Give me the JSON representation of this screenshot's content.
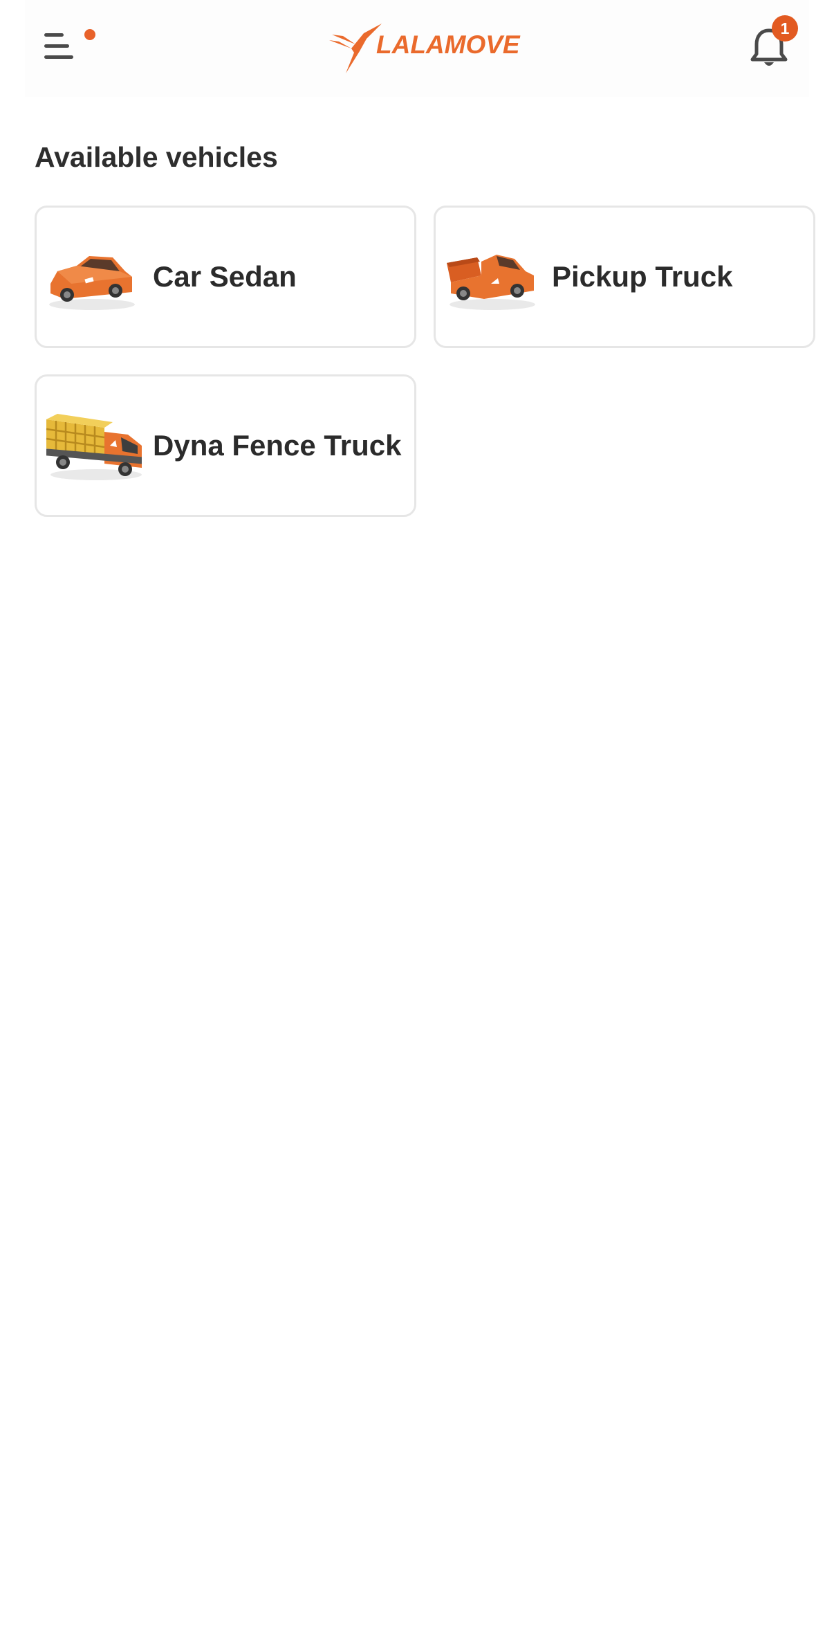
{
  "header": {
    "brand": "LALAMOVE",
    "brand_color": "#EA6A2C",
    "menu_icon": "menu-icon",
    "notification_icon": "bell-icon",
    "notification_count": "1"
  },
  "main": {
    "section_title": "Available vehicles",
    "vehicles": [
      {
        "label": "Car Sedan",
        "icon": "car-sedan-icon"
      },
      {
        "label": "Pickup Truck",
        "icon": "pickup-truck-icon"
      },
      {
        "label": "Dyna Fence Truck",
        "icon": "dyna-fence-truck-icon"
      }
    ]
  }
}
